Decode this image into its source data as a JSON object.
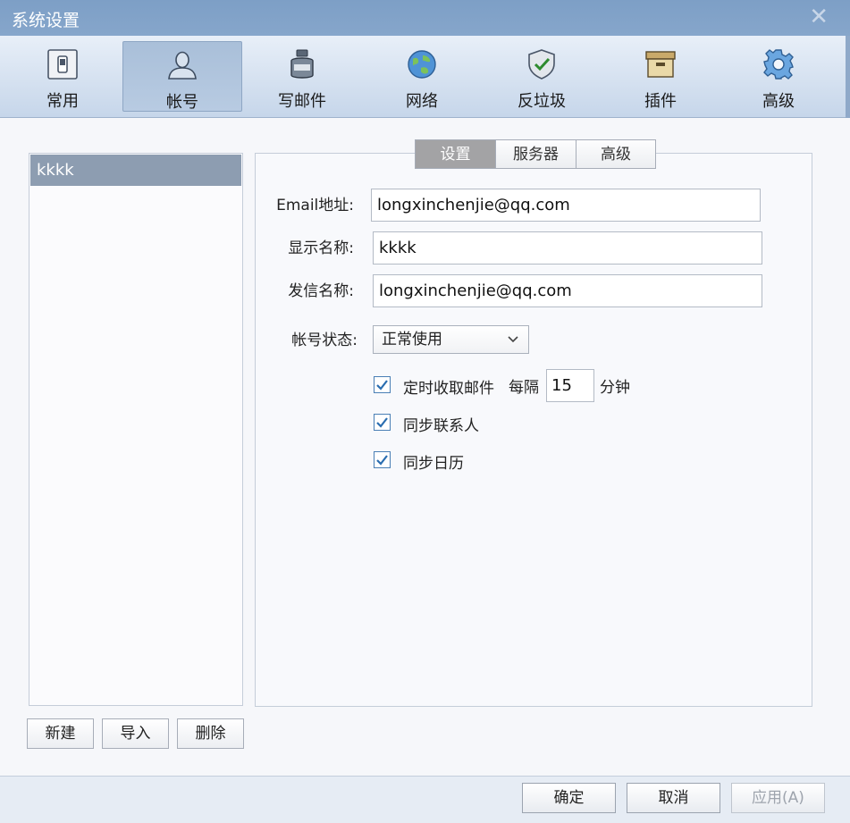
{
  "window": {
    "title": "系统设置",
    "close_symbol": "✕"
  },
  "toolbar": {
    "items": [
      {
        "label": "常用",
        "icon": "switch-icon"
      },
      {
        "label": "帐号",
        "icon": "user-icon",
        "active": true
      },
      {
        "label": "写邮件",
        "icon": "ink-bottle-icon"
      },
      {
        "label": "网络",
        "icon": "globe-icon"
      },
      {
        "label": "反垃圾",
        "icon": "shield-icon"
      },
      {
        "label": "插件",
        "icon": "box-icon"
      },
      {
        "label": "高级",
        "icon": "gear-icon"
      }
    ]
  },
  "accounts": {
    "items": [
      "kkkk"
    ],
    "selected": "kkkk",
    "buttons": {
      "new": "新建",
      "import": "导入",
      "delete": "删除"
    }
  },
  "tabs": {
    "settings": "设置",
    "server": "服务器",
    "advanced": "高级",
    "active": "设置"
  },
  "form": {
    "email": {
      "label": "Email地址:",
      "value": "longxinchenjie@qq.com"
    },
    "display_name": {
      "label": "显示名称:",
      "value": "kkkk"
    },
    "sender_name": {
      "label": "发信名称:",
      "value": "longxinchenjie@qq.com"
    },
    "status": {
      "label": "帐号状态:",
      "value": "正常使用"
    },
    "schedule": {
      "label": "定时收取邮件",
      "checked": true,
      "every_label": "每隔",
      "interval": "15",
      "unit": "分钟"
    },
    "sync_contacts": {
      "label": "同步联系人",
      "checked": true
    },
    "sync_calendar": {
      "label": "同步日历",
      "checked": true
    }
  },
  "footer": {
    "ok": "确定",
    "cancel": "取消",
    "apply": "应用(A)"
  },
  "colors": {
    "accent": "#7d9fc6",
    "selected_row": "#8d9db1",
    "check": "#2a6db0"
  }
}
